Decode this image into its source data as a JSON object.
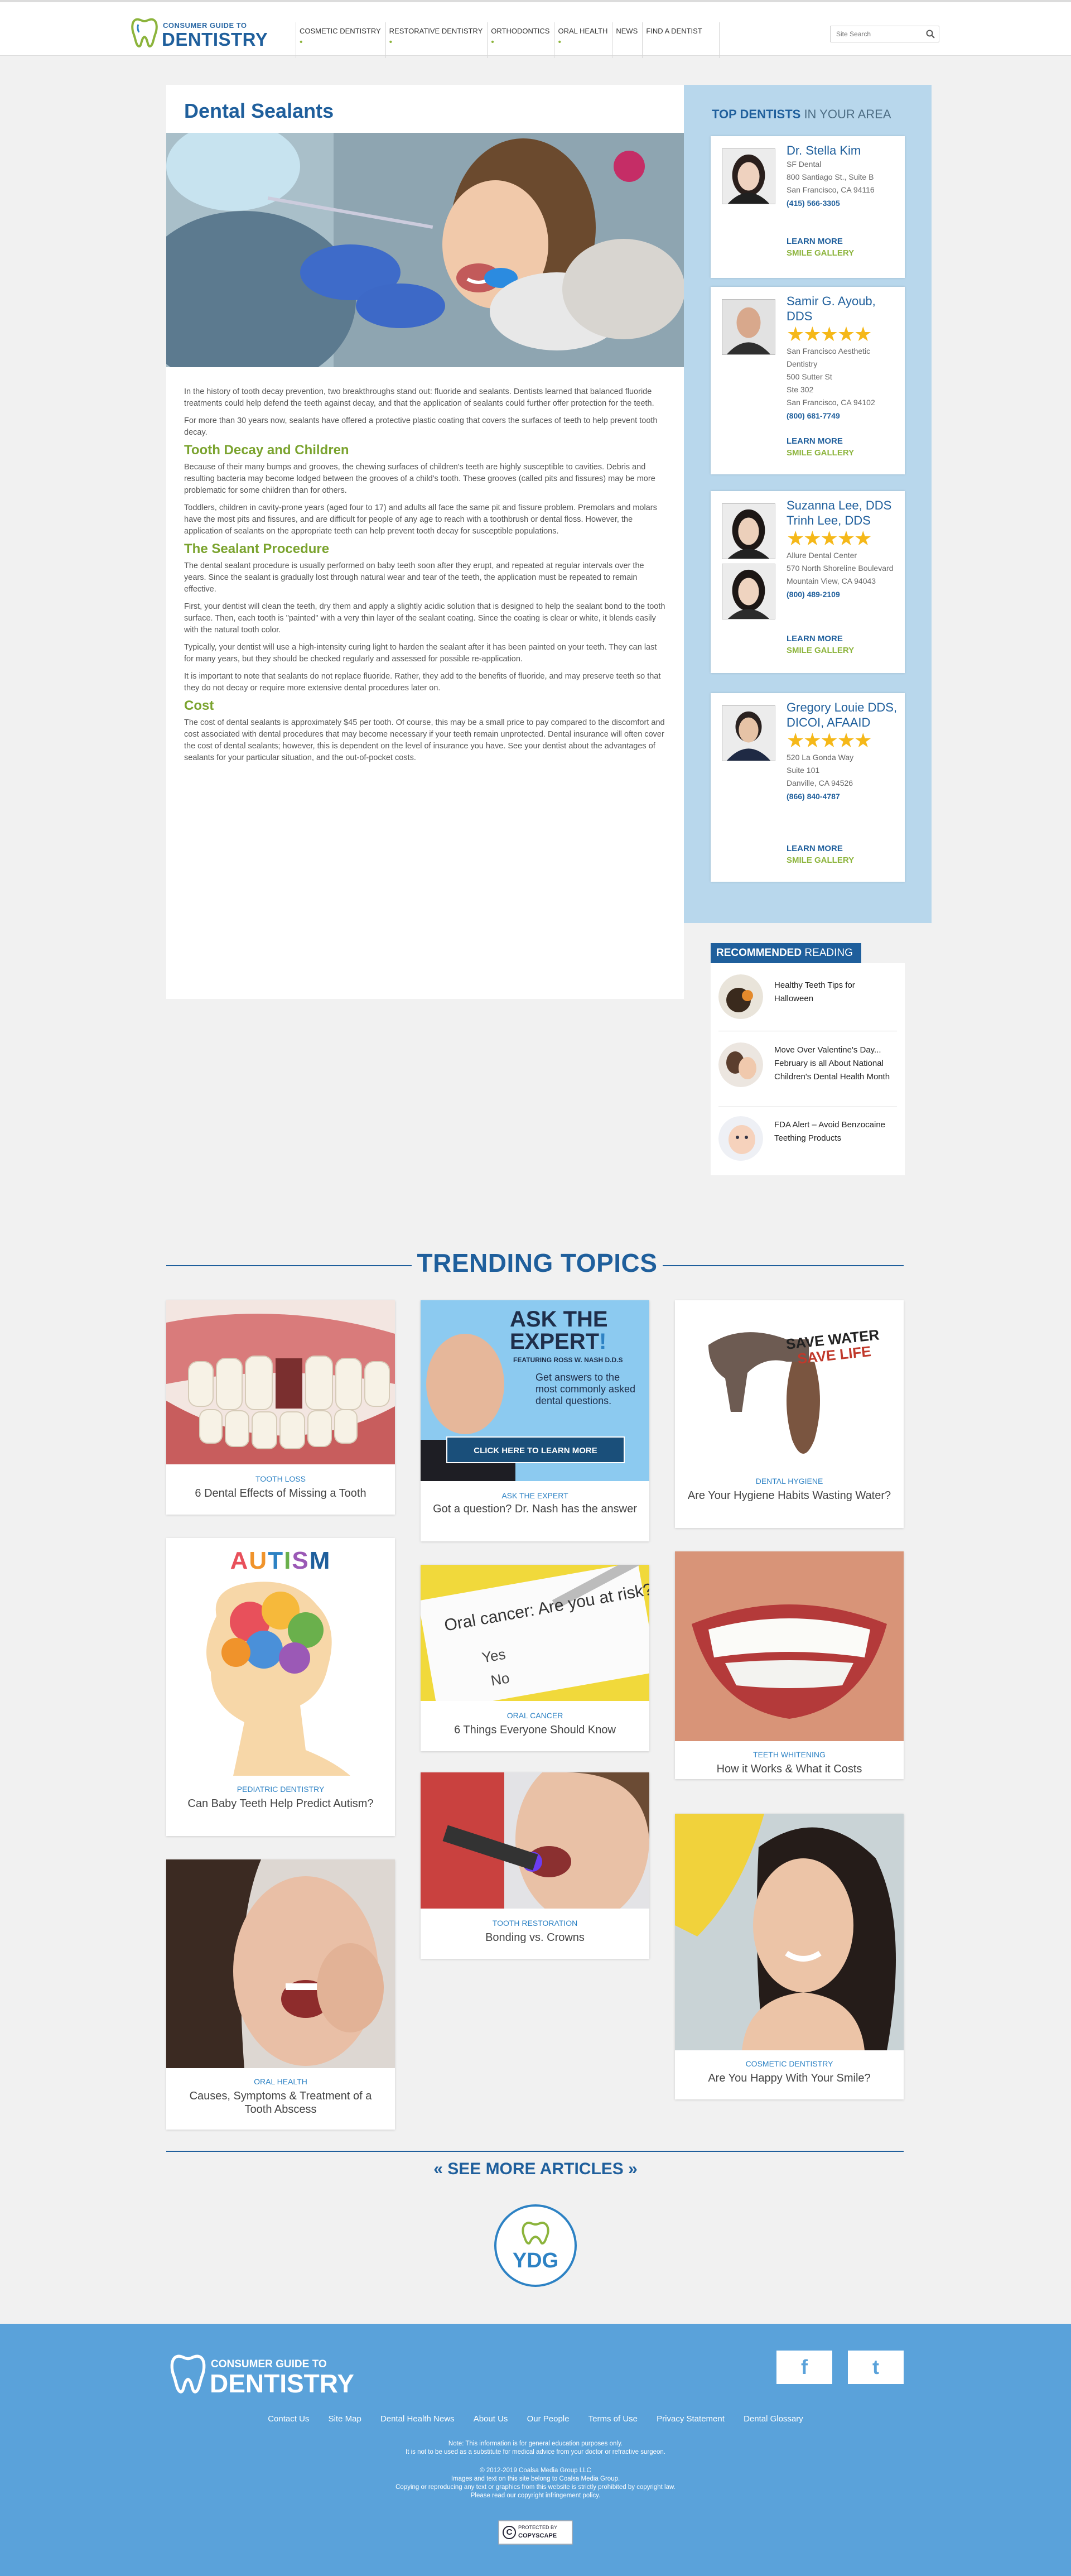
{
  "header": {
    "logo_small": "CONSUMER GUIDE TO",
    "logo_big": "DENTISTRY",
    "nav": [
      {
        "label": "COSMETIC DENTISTRY",
        "dot": "•"
      },
      {
        "label": "RESTORATIVE DENTISTRY",
        "dot": "•"
      },
      {
        "label": "ORTHODONTICS",
        "dot": "•"
      },
      {
        "label": "ORAL HEALTH",
        "dot": "•"
      },
      {
        "label": "NEWS",
        "dot": ""
      },
      {
        "label": "FIND A DENTIST",
        "dot": ""
      }
    ],
    "search_placeholder": "Site Search"
  },
  "article": {
    "title": "Dental Sealants",
    "p1": "In the history of tooth decay prevention, two breakthroughs stand out: fluoride and sealants. Dentists learned that balanced fluoride treatments could help defend the teeth against decay, and that the application of sealants could further offer protection for the teeth.",
    "p2": "For more than 30 years now, sealants have offered a protective plastic coating that covers the surfaces of teeth to help prevent tooth decay.",
    "h_decay": "Tooth Decay and Children",
    "p3": "Because of their many bumps and grooves, the chewing surfaces of children's teeth are highly susceptible to cavities. Debris and resulting bacteria may become lodged between the grooves of a child's tooth. These grooves (called pits and fissures) may be more problematic for some children than for others.",
    "p4": "Toddlers, children in cavity-prone years (aged four to 17) and adults all face the same pit and fissure problem. Premolars and molars have the most pits and fissures, and are difficult for people of any age to reach with a toothbrush or dental floss. However, the application of sealants on the appropriate teeth can help prevent tooth decay for susceptible populations.",
    "h_procedure": "The Sealant Procedure",
    "p5": "The dental sealant procedure is usually performed on baby teeth soon after they erupt, and repeated at regular intervals over the years. Since the sealant is gradually lost through natural wear and tear of the teeth, the application must be repeated to remain effective.",
    "p6": "First, your dentist will clean the teeth, dry them and apply a slightly acidic solution that is designed to help the sealant bond to the tooth surface. Then, each tooth is \"painted\" with a very thin layer of the sealant coating. Since the coating is clear or white, it blends easily with the natural tooth color.",
    "p7": "Typically, your dentist will use a high-intensity curing light to harden the sealant after it has been painted on your teeth. They can last for many years, but they should be checked regularly and assessed for possible re-application.",
    "p8": "It is important to note that sealants do not replace fluoride. Rather, they add to the benefits of fluoride, and may preserve teeth so that they do not decay or require more extensive dental procedures later on.",
    "h_cost": "Cost",
    "p9": "The cost of dental sealants is approximately $45 per tooth. Of course, this may be a small price to pay compared to the discomfort and cost associated with dental procedures that may become necessary if your teeth remain unprotected. Dental insurance will often cover the cost of dental sealants; however, this is dependent on the level of insurance you have. See your dentist about the advantages of sealants for your particular situation, and the out-of-pocket costs."
  },
  "sidebar": {
    "title_bold": "TOP DENTISTS",
    "title_rest": " IN YOUR AREA",
    "learn_more": "LEARN MORE",
    "smile_gallery": "SMILE GALLERY",
    "dentists": [
      {
        "name": "Dr. Stella Kim",
        "lines": [
          "SF Dental",
          "800 Santiago St., Suite B",
          "San Francisco, CA 94116"
        ],
        "phone": "(415) 566-3305",
        "stars": ""
      },
      {
        "name": "Samir G. Ayoub, DDS",
        "lines": [
          "San Francisco Aesthetic Dentistry",
          "500 Sutter St",
          "Ste 302",
          "San Francisco, CA 94102"
        ],
        "phone": "(800) 681-7749",
        "stars": "★★★★★"
      },
      {
        "name": "Suzanna Lee, DDS Trinh Lee, DDS",
        "lines": [
          "Allure Dental Center",
          "570 North Shoreline Boulevard",
          "Mountain View, CA 94043"
        ],
        "phone": "(800) 489-2109",
        "stars": "★★★★★"
      },
      {
        "name": "Gregory Louie DDS, DICOI, AFAAID",
        "lines": [
          "520 La Gonda Way",
          "Suite 101",
          "Danville, CA 94526"
        ],
        "phone": "(866) 840-4787",
        "stars": "★★★★★"
      }
    ]
  },
  "recommended": {
    "bold": "RECOMMENDED",
    "rest": " READING",
    "items": [
      "Healthy Teeth Tips for Halloween",
      "Move Over Valentine's Day... February is all About National Children's Dental Health Month",
      "FDA Alert – Avoid Benzocaine Teething Products"
    ]
  },
  "trending": {
    "title": "TRENDING TOPICS",
    "cards": [
      {
        "cat": "TOOTH LOSS",
        "title": "6 Dental Effects of Missing a Tooth"
      },
      {
        "cat": "ASK THE EXPERT",
        "title": "Got a question? Dr. Nash has the answer"
      },
      {
        "cat": "DENTAL HYGIENE",
        "title": "Are Your Hygiene Habits Wasting Water?"
      },
      {
        "cat": "PEDIATRIC DENTISTRY",
        "title": "Can Baby Teeth Help Predict Autism?"
      },
      {
        "cat": "ORAL CANCER",
        "title": "6 Things Everyone Should Know"
      },
      {
        "cat": "TEETH WHITENING",
        "title": "How it Works & What it Costs"
      },
      {
        "cat": "ORAL HEALTH",
        "title": "Causes, Symptoms & Treatment of a Tooth Abscess"
      },
      {
        "cat": "TOOTH RESTORATION",
        "title": "Bonding vs. Crowns"
      },
      {
        "cat": "COSMETIC DENTISTRY",
        "title": "Are You Happy With Your Smile?"
      }
    ],
    "ask_expert": {
      "line1": "ASK THE",
      "line2": "EXPERT",
      "excl": "!",
      "featuring": "FEATURING ROSS W. NASH D.D.S",
      "blurb": "Get answers to the most commonly asked dental questions.",
      "button": "CLICK HERE TO LEARN MORE"
    },
    "autism_word": "AUTISM",
    "water_line1": "SAVE WATER",
    "water_line2": "SAVE LIFE",
    "oral_cancer_text": "Oral cancer: Are you at risk?",
    "oral_yes": "Yes",
    "oral_no": "No",
    "see_more": "« SEE MORE ARTICLES »",
    "ydg": "YDG"
  },
  "footer": {
    "logo_small": "CONSUMER GUIDE TO",
    "logo_big": "DENTISTRY",
    "facebook": "f",
    "twitter": "t",
    "links": [
      "Contact Us",
      "Site Map",
      "Dental Health News",
      "About Us",
      "Our People",
      "Terms of Use",
      "Privacy Statement",
      "Dental Glossary"
    ],
    "note1": "Note: This information is for general education purposes only.",
    "note2": "It is not to be used as a substitute for medical advice from your doctor or refractive surgeon.",
    "copy1": "© 2012-2019 Coalsa Media Group LLC",
    "copy2": "Images and text on this site belong to Coalsa Media Group.",
    "copy3": "Copying or reproducing any text or graphics from this website is strictly prohibited by copyright law.",
    "copy4": "Please read our copyright infringement policy.",
    "copyscape1": "PROTECTED BY",
    "copyscape2": "COPYSCAPE",
    "copyscape_c": "C"
  }
}
